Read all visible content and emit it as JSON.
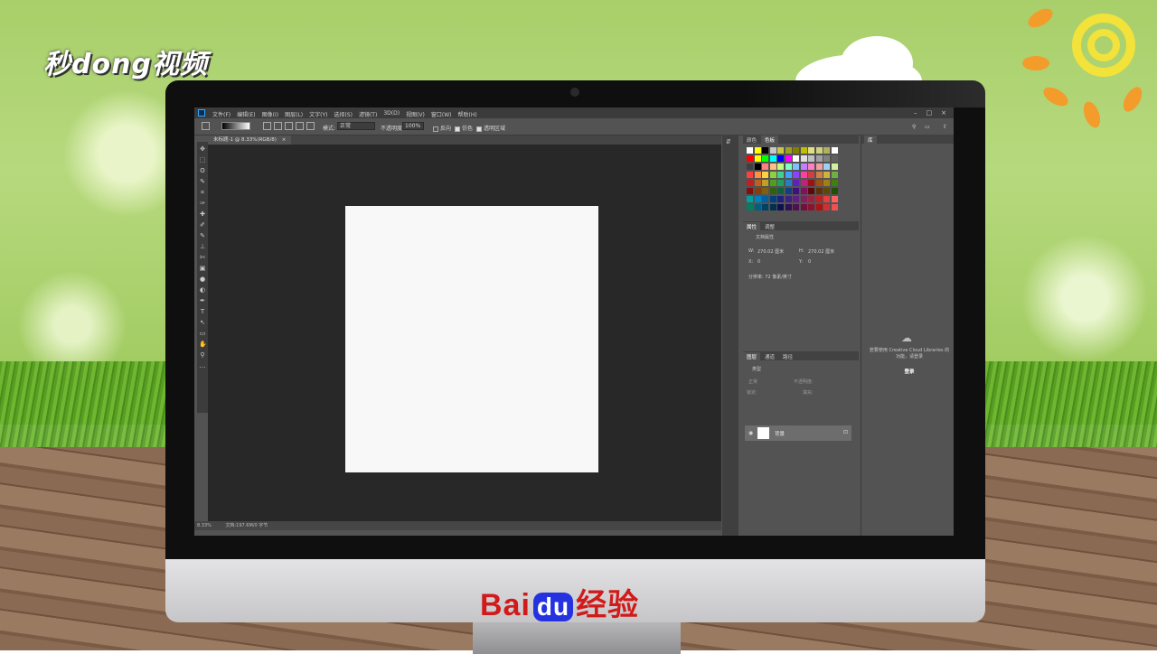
{
  "watermark": {
    "logo_text": "秒dong视频"
  },
  "brand": {
    "baidu_prefix": "Bai",
    "baidu_du": "du",
    "baidu_suffix": "经验"
  },
  "photoshop": {
    "menubar": {
      "app_icon": "Ps",
      "items": [
        "文件(F)",
        "编辑(E)",
        "图像(I)",
        "图层(L)",
        "文字(Y)",
        "选择(S)",
        "滤镜(T)",
        "3D(D)",
        "视图(V)",
        "窗口(W)",
        "帮助(H)"
      ],
      "window_controls": [
        "–",
        "□",
        "×"
      ]
    },
    "options_bar": {
      "mode_label": "模式:",
      "mode_value": "正常",
      "opacity_label": "不透明度:",
      "opacity_value": "100%",
      "reverse_label": "反向",
      "dither_label": "仿色",
      "transparency_label": "透明区域"
    },
    "document_tab": {
      "title": "未标题-1 @ 8.33%(RGB/8)",
      "close": "×"
    },
    "tools": [
      "✥",
      "⬚",
      "ʘ",
      "✎",
      "⌗",
      "✑",
      "✚",
      "✐",
      "✎",
      "⊥",
      "✄",
      "▣",
      "●",
      "◐",
      "✒",
      "T",
      "↖",
      "▭",
      "✋",
      "⚲",
      "…"
    ],
    "status_bar": {
      "zoom": "8.33%",
      "doc_info": "文档:197.6M/0 字节"
    },
    "color_panel": {
      "tabs": [
        "颜色",
        "色板"
      ],
      "active": "色板"
    },
    "properties_panel": {
      "tabs": [
        "属性",
        "调整"
      ],
      "title": "文档属性",
      "w_label": "W:",
      "w_value": "270.02 厘米",
      "h_label": "H:",
      "h_value": "270.02 厘米",
      "x_label": "X:",
      "x_value": "0",
      "y_label": "Y:",
      "y_value": "0",
      "resolution": "分辨率: 72 像素/英寸"
    },
    "layers_panel": {
      "tabs": [
        "图层",
        "通道",
        "路径"
      ],
      "filter_label": "类型",
      "blend_label": "正常",
      "opacity_label": "不透明度:",
      "lock_label": "锁定:",
      "fill_label": "填充:",
      "layer_name": "背景"
    },
    "libraries_panel": {
      "tab": "库",
      "message": "若要使用 Creative Cloud Libraries 的功能，请登录",
      "link": "登录"
    }
  },
  "swatch_colors": [
    "#ffffff",
    "#ffff00",
    "#000000",
    "#c8c8c8",
    "#c8c842",
    "#a0a020",
    "#808000",
    "#c0c000",
    "#e0e080",
    "#d0d080",
    "#b0b060",
    "#ffffff",
    "#ff0000",
    "#ffff00",
    "#00ff00",
    "#00ffff",
    "#0000ff",
    "#ff00ff",
    "#ffffff",
    "#e0e0e0",
    "#c0c0c0",
    "#a0a0a0",
    "#808080",
    "#606060",
    "#404040",
    "#000000",
    "#ff8080",
    "#ffc080",
    "#c0ff80",
    "#80ffc0",
    "#80c0ff",
    "#c080ff",
    "#ff80c0",
    "#f0a0a0",
    "#a0d0f0",
    "#d0f0a0",
    "#ff4040",
    "#ff9040",
    "#ffd040",
    "#90d040",
    "#40d090",
    "#40a0ff",
    "#9040ff",
    "#ff40a0",
    "#d04040",
    "#d08040",
    "#d0b040",
    "#70b040",
    "#c02020",
    "#c06020",
    "#c0a020",
    "#50a020",
    "#20a060",
    "#2080c0",
    "#6020c0",
    "#c02080",
    "#a01010",
    "#a05010",
    "#a08010",
    "#408010",
    "#801010",
    "#804010",
    "#806010",
    "#306010",
    "#106040",
    "#104080",
    "#401080",
    "#801060",
    "#600808",
    "#603008",
    "#604808",
    "#205008",
    "#00a0a0",
    "#0080c0",
    "#0060a0",
    "#004080",
    "#202080",
    "#402080",
    "#602080",
    "#802060",
    "#a02040",
    "#c02020",
    "#e04040",
    "#ff6060",
    "#008060",
    "#006080",
    "#004060",
    "#003050",
    "#101050",
    "#301050",
    "#501050",
    "#701040",
    "#901030",
    "#b01010",
    "#d03030",
    "#f05050"
  ]
}
